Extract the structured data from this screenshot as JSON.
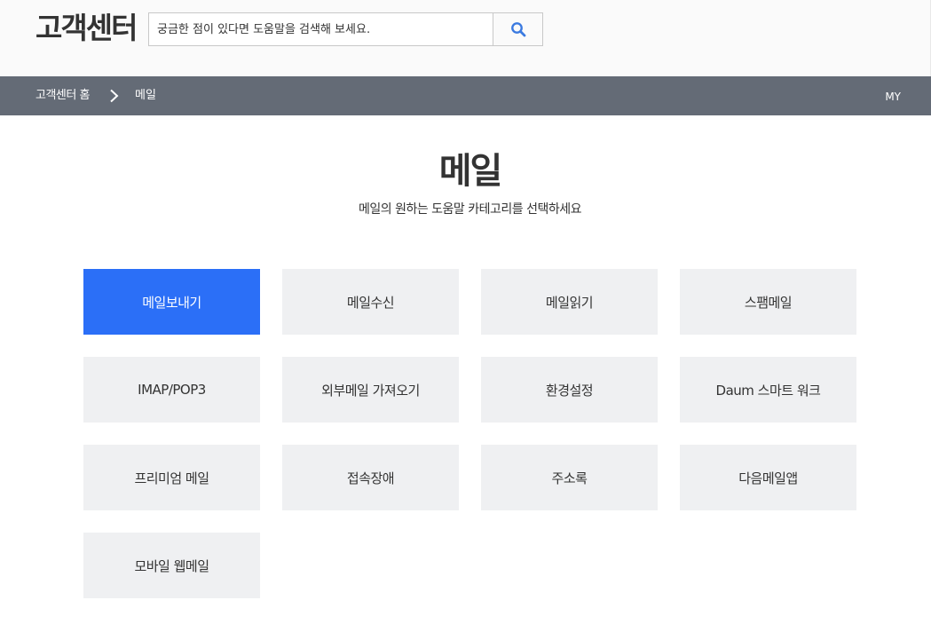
{
  "header": {
    "logo": "고객센터",
    "search": {
      "placeholder": "궁금한 점이 있다면 도움말을 검색해 보세요.",
      "value": "",
      "button_icon": "search-icon"
    }
  },
  "nav": {
    "home": "고객센터 홈",
    "separator_icon": "chevron-right-icon",
    "current": "메일",
    "my": "MY"
  },
  "main": {
    "title": "메일",
    "subtitle": "메일의 원하는 도움말 카테고리를 선택하세요"
  },
  "categories": [
    {
      "label": "메일보내기",
      "selected": true
    },
    {
      "label": "메일수신",
      "selected": false
    },
    {
      "label": "메일읽기",
      "selected": false
    },
    {
      "label": "스팸메일",
      "selected": false
    },
    {
      "label": "IMAP/POP3",
      "selected": false
    },
    {
      "label": "외부메일 가져오기",
      "selected": false
    },
    {
      "label": "환경설정",
      "selected": false
    },
    {
      "label": "Daum 스마트 워크",
      "selected": false
    },
    {
      "label": "프리미엄 메일",
      "selected": false
    },
    {
      "label": "접속장애",
      "selected": false
    },
    {
      "label": "주소록",
      "selected": false
    },
    {
      "label": "다음메일앱",
      "selected": false
    },
    {
      "label": "모바일 웹메일",
      "selected": false
    }
  ],
  "colors": {
    "accent": "#2b6ff7",
    "nav_bar": "#646b76",
    "tile": "#eff0f2",
    "search_icon": "#3b7ae0"
  }
}
